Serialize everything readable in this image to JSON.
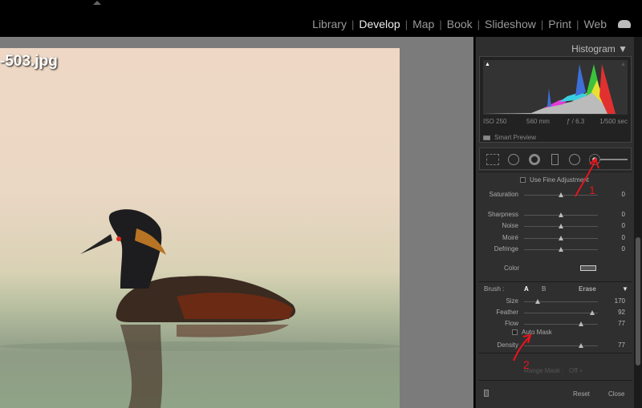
{
  "top": {
    "modules": [
      {
        "label": "Library",
        "active": false
      },
      {
        "label": "Develop",
        "active": true
      },
      {
        "label": "Map",
        "active": false
      },
      {
        "label": "Book",
        "active": false
      },
      {
        "label": "Slideshow",
        "active": false
      },
      {
        "label": "Print",
        "active": false
      },
      {
        "label": "Web",
        "active": false
      }
    ]
  },
  "photo": {
    "filename": "-503.jpg"
  },
  "histogram": {
    "title": "Histogram",
    "iso": "ISO 250",
    "focal": "560 mm",
    "aperture": "ƒ / 6.3",
    "shutter": "1/500 sec",
    "smart_preview": "Smart Preview"
  },
  "effects": {
    "fine_adjust": "Use Fine Adjustment",
    "color_label": "Color",
    "sliders": [
      {
        "label": "Saturation",
        "value": "0",
        "pos": 0.5
      },
      {
        "label": "Sharpness",
        "value": "0",
        "pos": 0.5
      },
      {
        "label": "Noise",
        "value": "0",
        "pos": 0.5
      },
      {
        "label": "Moiré",
        "value": "0",
        "pos": 0.5
      },
      {
        "label": "Defringe",
        "value": "0",
        "pos": 0.5
      }
    ]
  },
  "brush": {
    "label": "Brush :",
    "a": "A",
    "b": "B",
    "erase": "Erase",
    "auto_mask": "Auto Mask",
    "sliders": [
      {
        "label": "Size",
        "value": "170",
        "pos": 0.18
      },
      {
        "label": "Feather",
        "value": "92",
        "pos": 0.92
      },
      {
        "label": "Flow",
        "value": "77",
        "pos": 0.77
      },
      {
        "label": "Density",
        "value": "77",
        "pos": 0.77
      }
    ]
  },
  "range_mask": {
    "label": "Range Mask :",
    "value": "Off ÷"
  },
  "footer": {
    "reset": "Reset",
    "close": "Close"
  },
  "annotations": {
    "one": "1",
    "two": "2"
  },
  "colors": {
    "annotation": "#e8141c",
    "panel": "#2f2f2f"
  }
}
